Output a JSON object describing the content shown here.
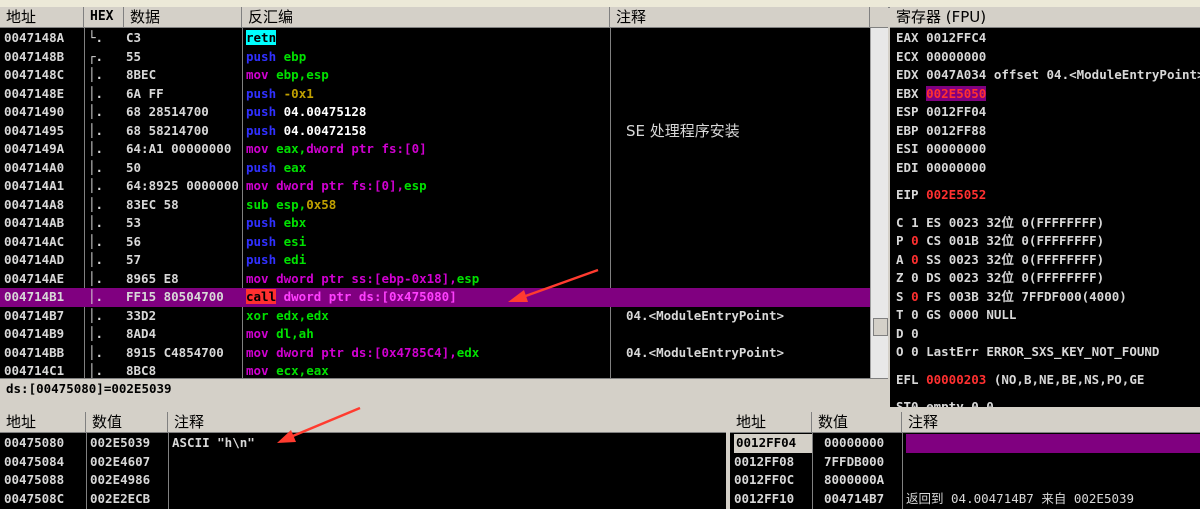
{
  "disasm": {
    "headers": {
      "addr": "地址",
      "hex": "HEX",
      "data": "数据",
      "disasm": "反汇编",
      "comment": "注释"
    },
    "rows": [
      {
        "addr": "0047148A",
        "mark": "└.",
        "hex": "C3",
        "parts": [
          {
            "t": "retn",
            "c": "#000000",
            "bg": "#00ffff"
          }
        ],
        "comment": ""
      },
      {
        "addr": "0047148B",
        "mark": "┌.",
        "hex": "55",
        "parts": [
          {
            "t": "push ",
            "c": "#3030ff"
          },
          {
            "t": "ebp",
            "c": "#00e000"
          }
        ],
        "comment": ""
      },
      {
        "addr": "0047148C",
        "mark": "│.",
        "hex": "8BEC",
        "parts": [
          {
            "t": "mov ",
            "c": "#d000d0"
          },
          {
            "t": "ebp,esp",
            "c": "#00e000"
          }
        ],
        "comment": ""
      },
      {
        "addr": "0047148E",
        "mark": "│.",
        "hex": "6A FF",
        "parts": [
          {
            "t": "push ",
            "c": "#3030ff"
          },
          {
            "t": "-0x1",
            "c": "#c0a000"
          }
        ],
        "comment": ""
      },
      {
        "addr": "00471490",
        "mark": "│.",
        "hex": "68 28514700",
        "parts": [
          {
            "t": "push ",
            "c": "#3030ff"
          },
          {
            "t": "04.00475128",
            "c": "#ffffff"
          }
        ],
        "comment": ""
      },
      {
        "addr": "00471495",
        "mark": "│.",
        "hex": "68 58214700",
        "parts": [
          {
            "t": "push ",
            "c": "#3030ff"
          },
          {
            "t": "04.00472158",
            "c": "#ffffff"
          }
        ],
        "comment": "SE 处理程序安装"
      },
      {
        "addr": "0047149A",
        "mark": "│.",
        "hex": "64:A1 00000000",
        "parts": [
          {
            "t": "mov ",
            "c": "#d000d0"
          },
          {
            "t": "eax,",
            "c": "#00e000"
          },
          {
            "t": "dword ptr fs:[0]",
            "c": "#d000d0"
          }
        ],
        "comment": ""
      },
      {
        "addr": "004714A0",
        "mark": "│.",
        "hex": "50",
        "parts": [
          {
            "t": "push ",
            "c": "#3030ff"
          },
          {
            "t": "eax",
            "c": "#00e000"
          }
        ],
        "comment": ""
      },
      {
        "addr": "004714A1",
        "mark": "│.",
        "hex": "64:8925 0000000",
        "parts": [
          {
            "t": "mov ",
            "c": "#d000d0"
          },
          {
            "t": "dword ptr fs:[0],",
            "c": "#d000d0"
          },
          {
            "t": "esp",
            "c": "#00e000"
          }
        ],
        "comment": ""
      },
      {
        "addr": "004714A8",
        "mark": "│.",
        "hex": "83EC 58",
        "parts": [
          {
            "t": "sub ",
            "c": "#00e000"
          },
          {
            "t": "esp,",
            "c": "#00e000"
          },
          {
            "t": "0x58",
            "c": "#c0a000"
          }
        ],
        "comment": ""
      },
      {
        "addr": "004714AB",
        "mark": "│.",
        "hex": "53",
        "parts": [
          {
            "t": "push ",
            "c": "#3030ff"
          },
          {
            "t": "ebx",
            "c": "#00e000"
          }
        ],
        "comment": ""
      },
      {
        "addr": "004714AC",
        "mark": "│.",
        "hex": "56",
        "parts": [
          {
            "t": "push ",
            "c": "#3030ff"
          },
          {
            "t": "esi",
            "c": "#00e000"
          }
        ],
        "comment": ""
      },
      {
        "addr": "004714AD",
        "mark": "│.",
        "hex": "57",
        "parts": [
          {
            "t": "push ",
            "c": "#3030ff"
          },
          {
            "t": "edi",
            "c": "#00e000"
          }
        ],
        "comment": ""
      },
      {
        "addr": "004714AE",
        "mark": "│.",
        "hex": "8965 E8",
        "parts": [
          {
            "t": "mov ",
            "c": "#d000d0"
          },
          {
            "t": "dword ptr ss:[ebp-0x18],",
            "c": "#d000d0"
          },
          {
            "t": "esp",
            "c": "#00e000"
          }
        ],
        "comment": ""
      },
      {
        "addr": "004714B1",
        "mark": "│.",
        "hex": "FF15 80504700",
        "parts": [
          {
            "t": "call",
            "c": "#000000",
            "bg": "#ff3030"
          },
          {
            "t": " dword ptr ds:[0x475080]",
            "c": "#ff40ff"
          }
        ],
        "comment": "",
        "selected": true
      },
      {
        "addr": "004714B7",
        "mark": "│.",
        "hex": "33D2",
        "parts": [
          {
            "t": "xor ",
            "c": "#00e000"
          },
          {
            "t": "edx,edx",
            "c": "#00e000"
          }
        ],
        "comment": "04.<ModuleEntryPoint>"
      },
      {
        "addr": "004714B9",
        "mark": "│.",
        "hex": "8AD4",
        "parts": [
          {
            "t": "mov ",
            "c": "#d000d0"
          },
          {
            "t": "dl,ah",
            "c": "#00e000"
          }
        ],
        "comment": ""
      },
      {
        "addr": "004714BB",
        "mark": "│.",
        "hex": "8915 C4854700",
        "parts": [
          {
            "t": "mov ",
            "c": "#d000d0"
          },
          {
            "t": "dword ptr ds:[0x4785C4],",
            "c": "#d000d0"
          },
          {
            "t": "edx",
            "c": "#00e000"
          }
        ],
        "comment": "04.<ModuleEntryPoint>"
      },
      {
        "addr": "004714C1",
        "mark": "│.",
        "hex": "8BC8",
        "parts": [
          {
            "t": "mov ",
            "c": "#d000d0"
          },
          {
            "t": "ecx,eax",
            "c": "#00e000"
          }
        ],
        "comment": ""
      }
    ],
    "info_line": "ds:[00475080]=002E5039"
  },
  "registers": {
    "title": "寄存器 (FPU)",
    "rows": [
      {
        "label": "EAX",
        "value": "0012FFC4",
        "extra": ""
      },
      {
        "label": "ECX",
        "value": "00000000",
        "extra": ""
      },
      {
        "label": "EDX",
        "value": "0047A034",
        "extra": "offset 04.<ModuleEntryPoint>"
      },
      {
        "label": "EBX",
        "value": "002E5050",
        "extra": "",
        "highlight": true
      },
      {
        "label": "ESP",
        "value": "0012FF04",
        "extra": ""
      },
      {
        "label": "EBP",
        "value": "0012FF88",
        "extra": ""
      },
      {
        "label": "ESI",
        "value": "00000000",
        "extra": ""
      },
      {
        "label": "EDI",
        "value": "00000000",
        "extra": ""
      }
    ],
    "eip": {
      "label": "EIP",
      "value": "002E5052"
    },
    "flags": [
      {
        "f": "C",
        "v": "1",
        "red": false,
        "seg": "ES 0023",
        "bits": "32位",
        "base": "0(FFFFFFFF)"
      },
      {
        "f": "P",
        "v": "0",
        "red": true,
        "seg": "CS 001B",
        "bits": "32位",
        "base": "0(FFFFFFFF)"
      },
      {
        "f": "A",
        "v": "0",
        "red": true,
        "seg": "SS 0023",
        "bits": "32位",
        "base": "0(FFFFFFFF)"
      },
      {
        "f": "Z",
        "v": "0",
        "red": false,
        "seg": "DS 0023",
        "bits": "32位",
        "base": "0(FFFFFFFF)"
      },
      {
        "f": "S",
        "v": "0",
        "red": true,
        "seg": "FS 003B",
        "bits": "32位",
        "base": "7FFDF000(4000)"
      },
      {
        "f": "T",
        "v": "0",
        "red": false,
        "seg": "GS 0000",
        "bits": "",
        "base": "NULL"
      },
      {
        "f": "D",
        "v": "0",
        "red": false,
        "seg": "",
        "bits": "",
        "base": ""
      },
      {
        "f": "O",
        "v": "0",
        "red": false,
        "seg": "LastErr",
        "bits": "",
        "base": "ERROR_SXS_KEY_NOT_FOUND"
      }
    ],
    "efl": {
      "label": "EFL",
      "value": "00000203",
      "extra": "(NO,B,NE,BE,NS,PO,GE"
    },
    "st0": "ST0 empty 0.0"
  },
  "dump": {
    "headers": {
      "addr": "地址",
      "value": "数值",
      "comment": "注释"
    },
    "rows": [
      {
        "addr": "00475080",
        "value": "002E5039",
        "comment": "ASCII \"h\\n\""
      },
      {
        "addr": "00475084",
        "value": "002E4607",
        "comment": ""
      },
      {
        "addr": "00475088",
        "value": "002E4986",
        "comment": ""
      },
      {
        "addr": "0047508C",
        "value": "002E2ECB",
        "comment": ""
      }
    ]
  },
  "stack": {
    "headers": {
      "addr": "地址",
      "value": "数值",
      "comment": "注释"
    },
    "rows": [
      {
        "addr": "0012FF04",
        "value": "00000000",
        "comment": "",
        "selected": true
      },
      {
        "addr": "0012FF08",
        "value": "7FFDB000",
        "comment": ""
      },
      {
        "addr": "0012FF0C",
        "value": "8000000A",
        "comment": ""
      },
      {
        "addr": "0012FF10",
        "value": "004714B7",
        "comment": "返回到 04.004714B7 来自 002E5039"
      }
    ]
  },
  "colors": {
    "selection": "#800080",
    "annotation_arrow": "#ff3b2f"
  }
}
